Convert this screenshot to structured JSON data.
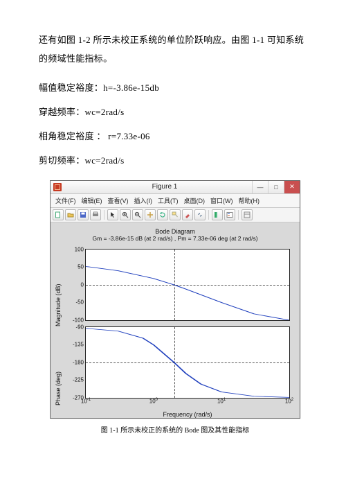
{
  "prose": {
    "intro": "还有如图 1-2 所示未校正系统的单位阶跃响应。由图 1-1 可知系统的频域性能指标。",
    "line_gain": "幅值稳定裕度：h=-3.86e-15db",
    "line_wc1": "穿越频率：wc=2rad/s",
    "line_phase": "相角稳定裕度 ： r=7.33e-06",
    "line_wc2": "剪切频率：wc=2rad/s"
  },
  "figure_window": {
    "title": "Figure 1",
    "menu": [
      "文件(F)",
      "编辑(E)",
      "查看(V)",
      "插入(I)",
      "工具(T)",
      "桌面(D)",
      "窗口(W)",
      "帮助(H)"
    ],
    "tool_icons": [
      "new-file-icon",
      "open-icon",
      "save-icon",
      "print-icon",
      "pointer-icon",
      "zoom-in-icon",
      "zoom-out-icon",
      "pan-icon",
      "rotate-icon",
      "datatip-icon",
      "brush-icon",
      "link-icon",
      "colorbar-icon",
      "legend-icon",
      "layout-icon"
    ]
  },
  "chart_data": [
    {
      "type": "line",
      "title": "Bode Diagram",
      "subtitle": "Gm = -3.86e-15 dB (at 2 rad/s) ,  Pm = 7.33e-06 deg (at 2 rad/s)",
      "ylabel": "Magnitude (dB)",
      "x_scale": "log",
      "xlim": [
        0.1,
        100
      ],
      "ylim": [
        -100,
        100
      ],
      "yticks": [
        -100,
        -50,
        0,
        50,
        100
      ],
      "ref_line_y": 0,
      "ref_line_x": 2,
      "x": [
        0.1,
        0.3,
        1,
        2,
        3,
        10,
        30,
        100
      ],
      "values": [
        52,
        40,
        18,
        0,
        -12,
        -50,
        -82,
        -100
      ]
    },
    {
      "type": "line",
      "ylabel": "Phase (deg)",
      "xlabel": "Frequency  (rad/s)",
      "x_scale": "log",
      "xlim": [
        0.1,
        100
      ],
      "ylim": [
        -270,
        -90
      ],
      "yticks": [
        -270,
        -225,
        -180,
        -135,
        -90
      ],
      "xticks": [
        0.1,
        1,
        10,
        100
      ],
      "xtick_labels": [
        "10^-1",
        "10^0",
        "10^1",
        "10^2"
      ],
      "ref_line_y": -180,
      "ref_line_x": 2,
      "x": [
        0.1,
        0.3,
        0.7,
        1,
        2,
        3,
        5,
        10,
        30,
        100
      ],
      "values": [
        -93,
        -100,
        -118,
        -135,
        -180,
        -208,
        -235,
        -255,
        -266,
        -269
      ]
    }
  ],
  "caption": "图 1-1 所示未校正的系统的 Bode 图及其性能指标"
}
